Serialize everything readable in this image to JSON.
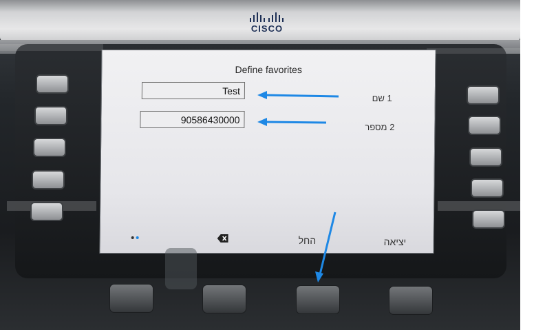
{
  "brand": {
    "logo_text": "CISCO"
  },
  "screen": {
    "title": "Define favorites",
    "rows": [
      {
        "index": "1",
        "label": "שם",
        "value": "Test"
      },
      {
        "index": "2",
        "label": "מספר",
        "value": "90586430000"
      }
    ],
    "softkeys": {
      "exit": "יציאה",
      "start": "החל",
      "backspace_icon": "backspace-icon",
      "page_dots_icon": "page-dots-icon"
    }
  },
  "annotation_color": "#1e88e5"
}
